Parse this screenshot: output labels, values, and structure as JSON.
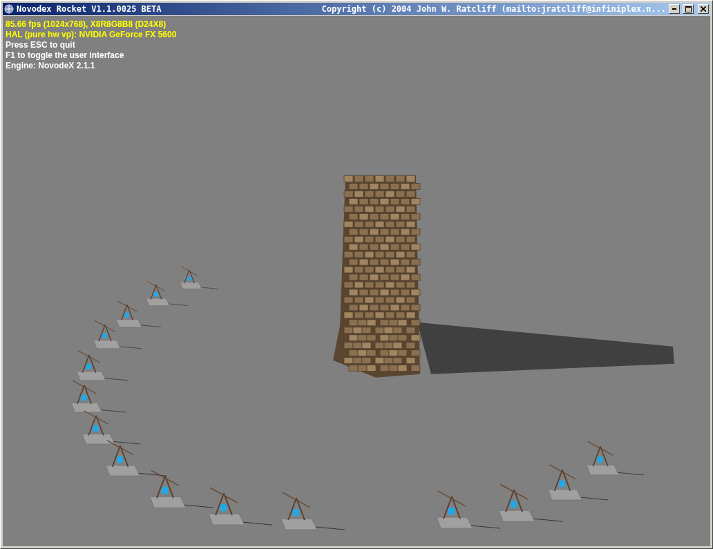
{
  "window": {
    "title": "Novodex Rocket V1.1.0025 BETA",
    "copyright": "Copyright (c) 2004 John W. Ratcliff (mailto:jratcliff@infiniplex.n..."
  },
  "overlay_lines": [
    {
      "text": "85.66 fps (1024x768), X8R8G8B8 (D24X8)",
      "color": "#ffff00"
    },
    {
      "text": "HAL (pure hw vp): NVIDIA GeForce FX 5600",
      "color": "#ffff00"
    },
    {
      "text": "Press ESC to quit",
      "color": "#ffffff"
    },
    {
      "text": "F1 to toggle the user interface",
      "color": "#ffffff"
    },
    {
      "text": "Engine: NovodeX 2.1.1",
      "color": "#ffffff"
    }
  ]
}
